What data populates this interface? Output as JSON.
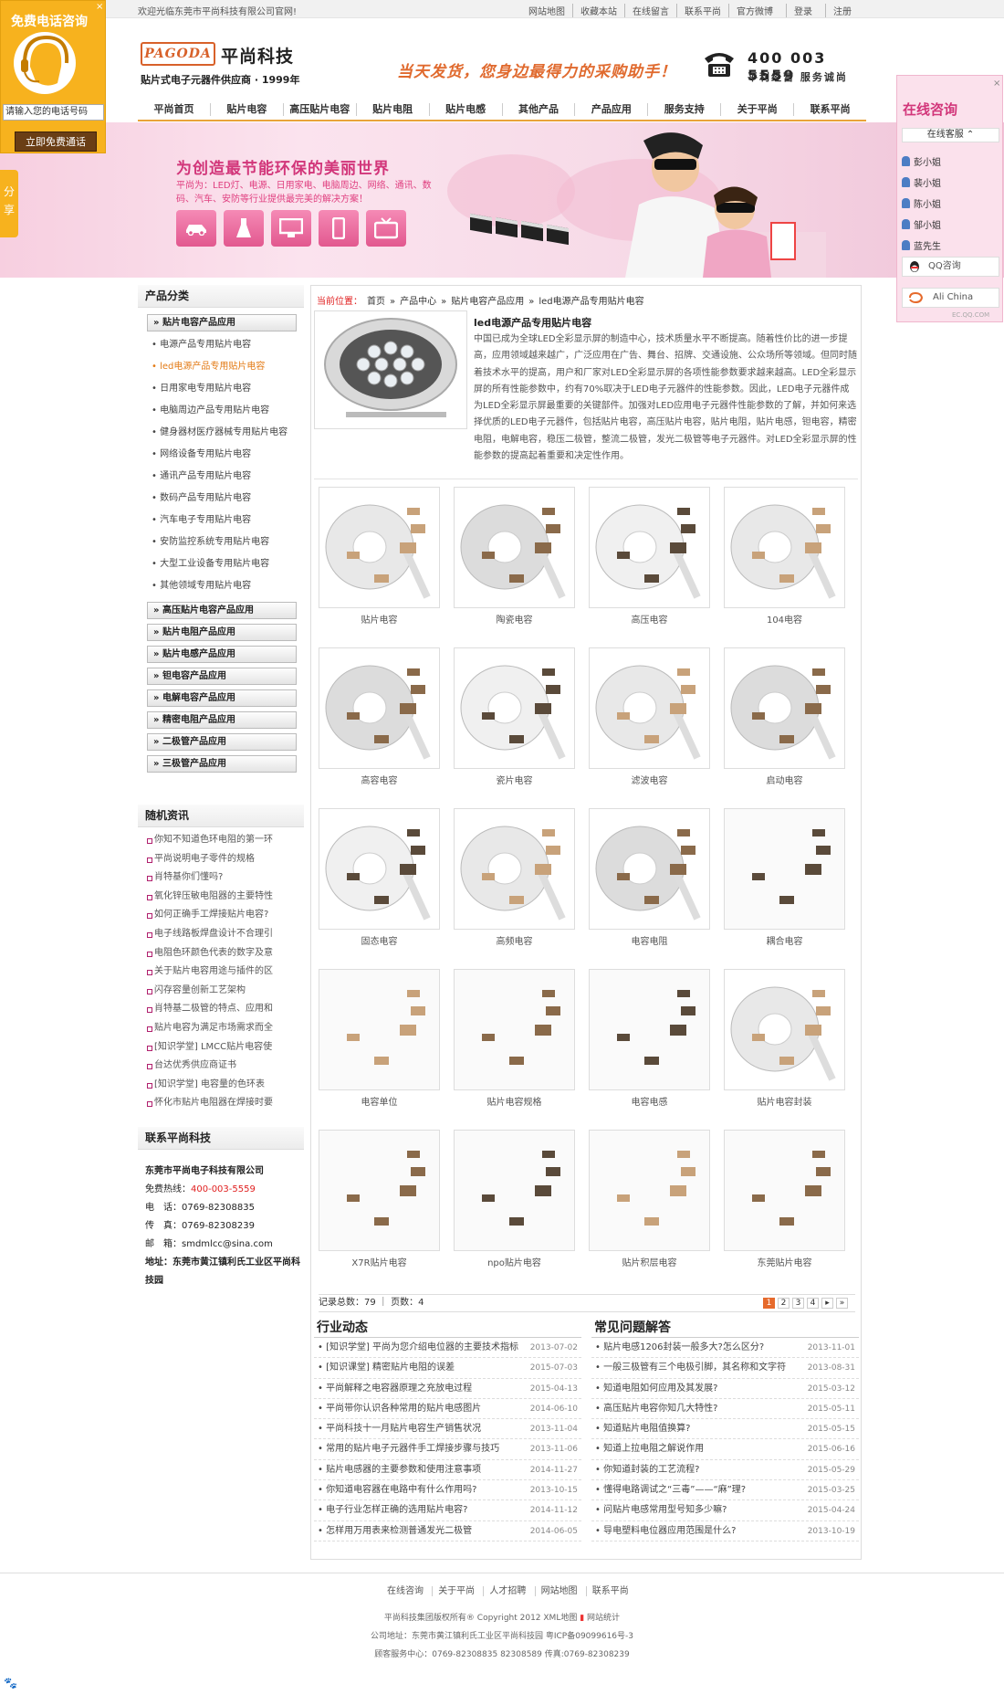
{
  "topbar": {
    "welcome": "欢迎光临东莞市平尚科技有限公司官网!",
    "links": [
      "网站地图",
      "收藏本站",
      "在线留言",
      "联系平尚",
      "官方微博",
      "登录",
      "注册"
    ]
  },
  "header": {
    "logo_en": "PAGODA",
    "logo_cn": "平尚科技",
    "logo_sub": "贴片式电子元器件供应商 · 1999年",
    "slogan": "当天发货，您身边最得力的采购助手！",
    "phone": "400 003 5559",
    "phone_sub": "平利经营 服务诚尚"
  },
  "nav": [
    "平尚首页",
    "贴片电容",
    "高压贴片电容",
    "贴片电阻",
    "贴片电感",
    "其他产品",
    "产品应用",
    "服务支持",
    "关于平尚",
    "联系平尚"
  ],
  "banner": {
    "title": "为创造最节能环保的美丽世界",
    "text": "平尚为：LED灯、电源、日用家电、电脑周边、网络、通讯、数码、汽车、安防等行业提供最完美的解决方案！"
  },
  "float_left": {
    "title": "免费电话咨询",
    "close": "×",
    "input_placeholder": "请输入您的电话号码",
    "button": "立即免费通话"
  },
  "share": "分享",
  "online": {
    "title": "在线咨询",
    "close": "×",
    "header": "在线客服",
    "staff": [
      "彭小姐",
      "裴小姐",
      "陈小姐",
      "邹小姐",
      "蓝先生"
    ],
    "qq": "QQ咨询",
    "ali": "Ali China",
    "foot": "EC.QQ.COM"
  },
  "sidebar": {
    "cat_title": "产品分类",
    "cat_main": "贴片电容产品应用",
    "cat_items": [
      "电源产品专用贴片电容",
      "led电源产品专用贴片电容",
      "日用家电专用贴片电容",
      "电脑周边产品专用贴片电容",
      "健身器材医疗器械专用贴片电容",
      "网络设备专用贴片电容",
      "通讯产品专用贴片电容",
      "数码产品专用贴片电容",
      "汽车电子专用贴片电容",
      "安防监控系统专用贴片电容",
      "大型工业设备专用贴片电容",
      "其他领域专用贴片电容"
    ],
    "cat_groups": [
      "高压贴片电容产品应用",
      "贴片电阻产品应用",
      "贴片电感产品应用",
      "钽电容产品应用",
      "电解电容产品应用",
      "精密电阻产品应用",
      "二极管产品应用",
      "三极管产品应用"
    ],
    "news_title": "随机资讯",
    "news": [
      "你知不知道色环电阻的第一环",
      "平尚说明电子零件的规格",
      "肖特基你们懂吗?",
      "氧化锌压敏电阻器的主要特性",
      "如何正确手工焊接贴片电容?",
      "电子线路板焊盘设计不合理引",
      "电阻色环颜色代表的数字及意",
      "关于贴片电容用途与插件的区",
      "闪存容量创新工艺架构",
      "肖特基二极管的特点、应用和",
      "贴片电容为满足市场需求而全",
      "[知识学堂] LMCC贴片电容使",
      "台达优秀供应商证书",
      "[知识学堂] 电容量的色环表",
      "怀化市贴片电阻器在焊接时要"
    ],
    "contact_title": "联系平尚科技",
    "company": "东莞市平尚电子科技有限公司",
    "hotline_label": "免费热线：",
    "hotline": "400-003-5559",
    "tel": "电　话：0769-82308835",
    "fax": "传　真：0769-82308239",
    "email": "邮　箱：smdmlcc@sina.com",
    "address": "地址：东莞市黄江镇利氏工业区平尚科技园"
  },
  "main": {
    "crumb_label": "当前位置：",
    "crumbs": [
      "首页",
      "»",
      "产品中心",
      "»",
      "贴片电容产品应用",
      "»",
      "led电源产品专用贴片电容"
    ],
    "intro_title": "led电源产品专用贴片电容",
    "intro_text": "中国已成为全球LED全彩显示屏的制造中心，技术质量水平不断提高。随着性价比的进一步提高，应用领域越来越广，广泛应用在广告、舞台、招牌、交通设施、公众场所等领域。但同时随着技术水平的提高，用户和厂家对LED全彩显示屏的各项性能参数要求越来越高。LED全彩显示屏的所有性能参数中，约有70%取决于LED电子元器件的性能参数。因此，LED电子元器件成为LED全彩显示屏最重要的关键部件。加强对LED应用电子元器件性能参数的了解，并如何来选择优质的LED电子元器件，包括贴片电容，高压贴片电容，贴片电阻，贴片电感，钽电容，精密电阻，电解电容，稳压二极管，整流二极管，发光二极管等电子元器件。对LED全彩显示屏的性能参数的提高起着重要和决定性作用。",
    "products": [
      "贴片电容",
      "陶瓷电容",
      "高压电容",
      "104电容",
      "高容电容",
      "瓷片电容",
      "滤波电容",
      "启动电容",
      "固态电容",
      "高频电容",
      "电容电阻",
      "耦合电容",
      "电容单位",
      "贴片电容规格",
      "电容电感",
      "贴片电容封装",
      "X7R贴片电容",
      "npo贴片电容",
      "贴片积层电容",
      "东莞贴片电容"
    ],
    "pager_text": "记录总数：79 ｜ 页数：4",
    "pages": [
      "1",
      "2",
      "3",
      "4",
      "▸",
      "»"
    ],
    "industry_title": "行业动态",
    "industry": [
      {
        "t": "[知识学堂] 平尚为您介绍电位器的主要技术指标",
        "d": "2013-07-02"
      },
      {
        "t": "[知识课堂] 精密贴片电阻的误差",
        "d": "2015-07-03"
      },
      {
        "t": "平尚解释之电容器原理之充放电过程",
        "d": "2015-04-13"
      },
      {
        "t": "平尚带你认识各种常用的贴片电感图片",
        "d": "2014-06-10"
      },
      {
        "t": "平尚科技十一月贴片电容生产销售状况",
        "d": "2013-11-04"
      },
      {
        "t": "常用的贴片电子元器件手工焊接步骤与技巧",
        "d": "2013-11-06"
      },
      {
        "t": "贴片电感器的主要参数和使用注意事项",
        "d": "2014-11-27"
      },
      {
        "t": "你知道电容器在电路中有什么作用吗?",
        "d": "2013-10-15"
      },
      {
        "t": "电子行业怎样正确的选用贴片电容?",
        "d": "2014-11-12"
      },
      {
        "t": "怎样用万用表来检测普通发光二极管",
        "d": "2014-06-05"
      }
    ],
    "faq_title": "常见问题解答",
    "faq": [
      {
        "t": "贴片电感1206封装一般多大?怎么区分?",
        "d": "2013-11-01"
      },
      {
        "t": "一般三极管有三个电极引脚，其名称和文字符",
        "d": "2013-08-31"
      },
      {
        "t": "知道电阻如何应用及其发展?",
        "d": "2015-03-12"
      },
      {
        "t": "高压贴片电容你知几大特性?",
        "d": "2015-05-11"
      },
      {
        "t": "知道贴片电阻值换算?",
        "d": "2015-05-15"
      },
      {
        "t": "知道上拉电阻之解说作用",
        "d": "2015-06-16"
      },
      {
        "t": "你知道封装的工艺流程?",
        "d": "2015-05-29"
      },
      {
        "t": "懂得电路调试之“三毒”——“麻”理?",
        "d": "2015-03-25"
      },
      {
        "t": "问贴片电感常用型号知多少嘛?",
        "d": "2015-04-24"
      },
      {
        "t": "导电塑料电位器应用范围是什么?",
        "d": "2013-10-19"
      }
    ]
  },
  "footer": {
    "links": [
      "在线咨询",
      "关于平尚",
      "人才招聘",
      "网站地图",
      "联系平尚"
    ],
    "copyright": "平尚科技集团版权所有® Copyright 2012 XML地图",
    "stat": "网站统计",
    "address": "公司地址：东莞市黄江镇利氏工业区平尚科技园 粤ICP备09099616号-3",
    "service": "顾客服务中心：0769-82308835 82308589 传真:0769-82308239"
  },
  "colors": {
    "accent": "#e9a33a",
    "pink": "#d2367a",
    "orange": "#e66a2c",
    "float_bg": "#f7b21e"
  }
}
